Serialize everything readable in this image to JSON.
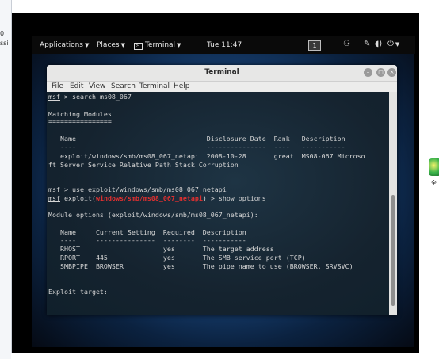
{
  "host": {
    "left_fragment_1": "0",
    "left_fragment_2": "ssi",
    "right_fragment": "全"
  },
  "topbar": {
    "applications": "Applications",
    "places": "Places",
    "terminal_app": "Terminal",
    "clock": "Tue 11:47",
    "workspace": "1"
  },
  "window": {
    "title": "Terminal",
    "menu": [
      "File",
      "Edit",
      "View",
      "Search",
      "Terminal",
      "Help"
    ]
  },
  "terminal": {
    "prompt": "msf",
    "cmd1": " > search ms08_067",
    "matching_title": "Matching Modules",
    "matching_rule": "================",
    "table_header": "   Name                                 Disclosure Date  Rank   Description",
    "table_rule": "   ----                                 ---------------  ----   -----------",
    "table_row": "   exploit/windows/smb/ms08_067_netapi  2008-10-28       great  MS08-067 Microso",
    "table_row_wrap": "ft Server Service Relative Path Stack Corruption",
    "cmd2": " > use exploit/windows/smb/ms08_067_netapi",
    "exploit_prefix": " exploit(",
    "exploit_module": "windows/smb/ms08_067_netapi",
    "exploit_suffix": ") > show options",
    "module_options": "Module options (exploit/windows/smb/ms08_067_netapi):",
    "opt_header": "   Name     Current Setting  Required  Description",
    "opt_rule": "   ----     ---------------  --------  -----------",
    "opt_rows": [
      "   RHOST                     yes       The target address",
      "   RPORT    445              yes       The SMB service port (TCP)",
      "   SMBPIPE  BROWSER          yes       The pipe name to use (BROWSER, SRVSVC)"
    ],
    "exploit_target": "Exploit target:"
  }
}
